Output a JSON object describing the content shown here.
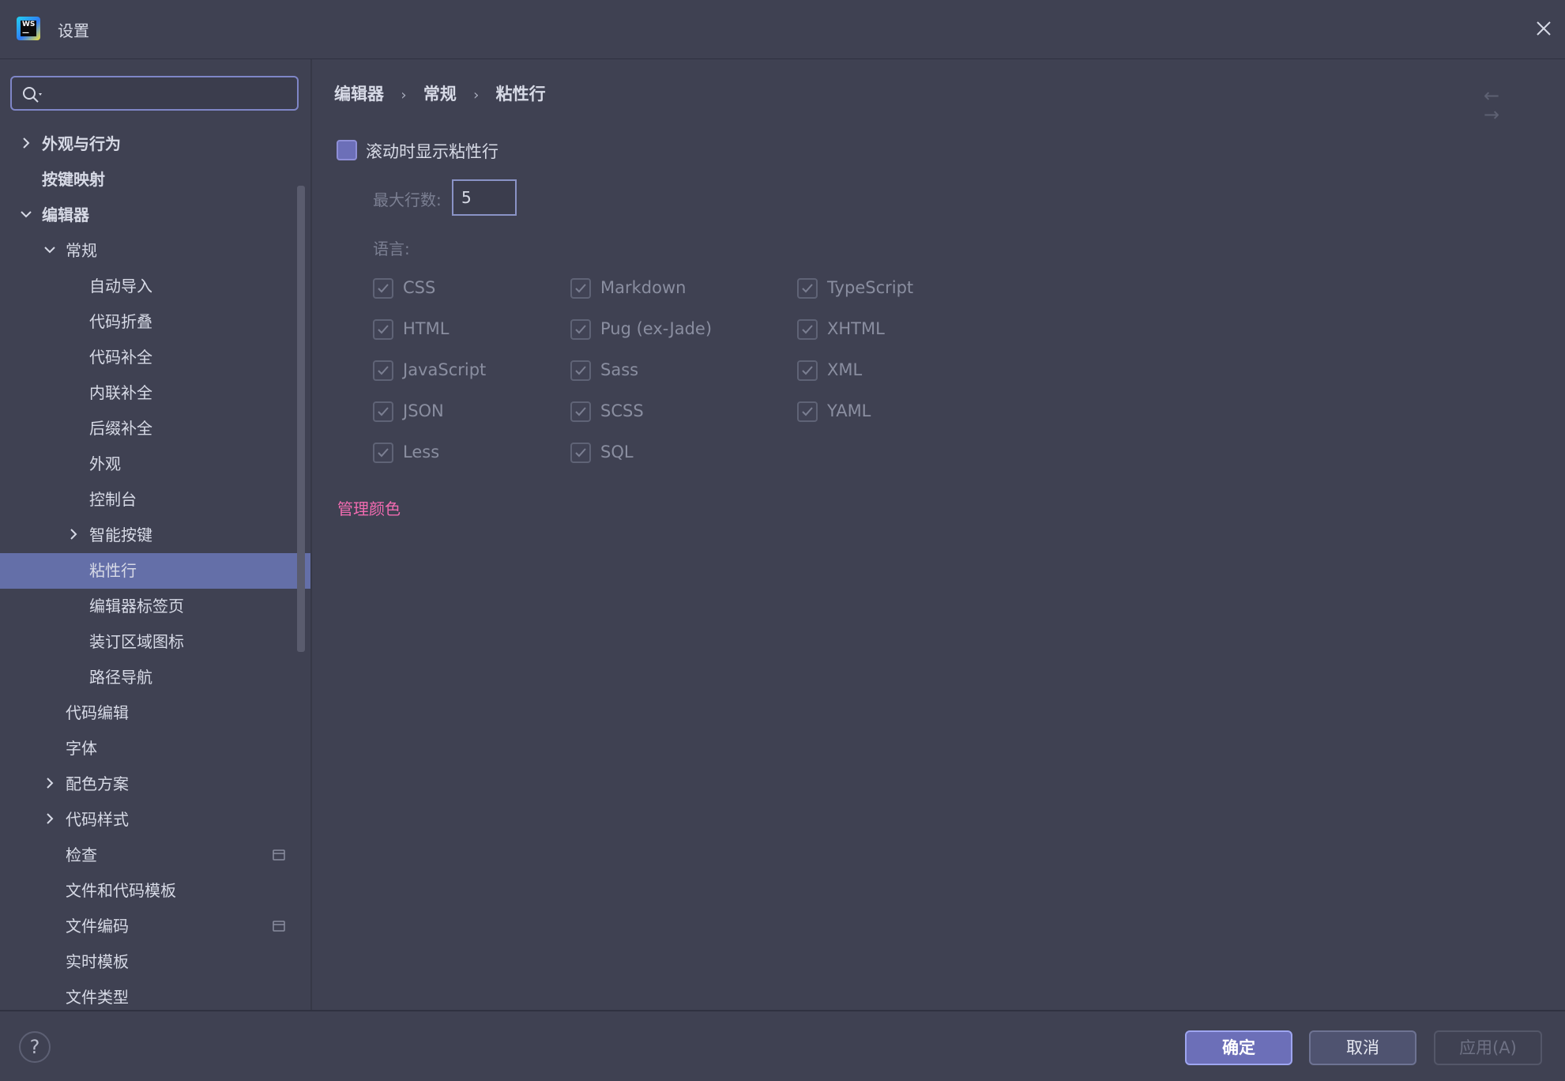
{
  "window": {
    "title": "设置"
  },
  "search": {
    "value": "",
    "placeholder": ""
  },
  "sidebar": {
    "items": [
      {
        "label": "外观与行为"
      },
      {
        "label": "按键映射"
      },
      {
        "label": "编辑器"
      },
      {
        "label": "常规"
      },
      {
        "label": "自动导入"
      },
      {
        "label": "代码折叠"
      },
      {
        "label": "代码补全"
      },
      {
        "label": "内联补全"
      },
      {
        "label": "后缀补全"
      },
      {
        "label": "外观"
      },
      {
        "label": "控制台"
      },
      {
        "label": "智能按键"
      },
      {
        "label": "粘性行"
      },
      {
        "label": "编辑器标签页"
      },
      {
        "label": "装订区域图标"
      },
      {
        "label": "路径导航"
      },
      {
        "label": "代码编辑"
      },
      {
        "label": "字体"
      },
      {
        "label": "配色方案"
      },
      {
        "label": "代码样式"
      },
      {
        "label": "检查"
      },
      {
        "label": "文件和代码模板"
      },
      {
        "label": "文件编码"
      },
      {
        "label": "实时模板"
      },
      {
        "label": "文件类型"
      }
    ],
    "selected": "粘性行"
  },
  "breadcrumb": {
    "items": [
      "编辑器",
      "常规",
      "粘性行"
    ],
    "separator": "›"
  },
  "nav": {
    "back": "←",
    "forward": "→"
  },
  "sticky": {
    "show_label": "滚动时显示粘性行",
    "show_checked": false,
    "max_lines_label": "最大行数:",
    "max_lines_value": "5",
    "languages_label": "语言:",
    "languages": [
      {
        "name": "CSS",
        "checked": true
      },
      {
        "name": "Markdown",
        "checked": true
      },
      {
        "name": "TypeScript",
        "checked": true
      },
      {
        "name": "HTML",
        "checked": true
      },
      {
        "name": "Pug (ex-Jade)",
        "checked": true
      },
      {
        "name": "XHTML",
        "checked": true
      },
      {
        "name": "JavaScript",
        "checked": true
      },
      {
        "name": "Sass",
        "checked": true
      },
      {
        "name": "XML",
        "checked": true
      },
      {
        "name": "JSON",
        "checked": true
      },
      {
        "name": "SCSS",
        "checked": true
      },
      {
        "name": "YAML",
        "checked": true
      },
      {
        "name": "Less",
        "checked": true
      },
      {
        "name": "SQL",
        "checked": true
      }
    ],
    "manage_colors": "管理颜色"
  },
  "footer": {
    "help": "?",
    "ok": "确定",
    "cancel": "取消",
    "apply": "应用(A)"
  },
  "colors": {
    "background": "#3f4152",
    "selection": "#646fa8",
    "accent": "#6c6fb8",
    "link": "#f06bb0"
  }
}
